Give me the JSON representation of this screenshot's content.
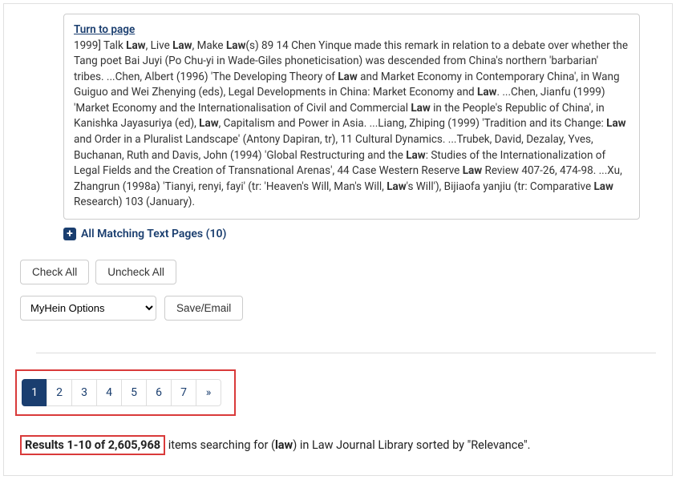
{
  "snippet": {
    "turn_label": "Turn to page",
    "prefix": "1999] Talk ",
    "hl1": "Law",
    "t1": ", Live ",
    "hl2": "Law",
    "t2": ", Make ",
    "hl3": "Law",
    "t3": "(s) 89 14 Chen Yinque made this remark in relation to a debate over whether the Tang poet Bai Juyi (Po Chu-yi in Wade-Giles phoneticisation) was descended from China's northern 'barbarian' tribes. ...Chen, Albert (1996) 'The Developing Theory of ",
    "hl4": "Law",
    "t4": " and Market Economy in Contemporary China', in Wang Guiguo and Wei Zhenying (eds), Legal Developments in China: Market Economy and ",
    "hl5": "Law",
    "t5": ". ...Chen, Jianfu (1999) 'Market Economy and the Internationalisation of Civil and Commercial ",
    "hl6": "Law",
    "t6": " in the People's Republic of China', in Kanishka Jayasuriya (ed), ",
    "hl7": "Law",
    "t7": ", Capitalism and Power in Asia. ...Liang, Zhiping (1999) 'Tradition and its Change: ",
    "hl8": "Law",
    "t8": " and Order in a Pluralist Landscape' (Antony Dapiran, tr), 11 Cultural Dynamics. ...Trubek, David, Dezalay, Yves, Buchanan, Ruth and Davis, John (1994) 'Global Restructuring and the ",
    "hl9": "Law",
    "t9": ": Studies of the Internationalization of Legal Fields and the Creation of Transnational Arenas', 44 Case Western Reserve ",
    "hl10": "Law",
    "t10": " Review 407-26, 474-98. ...Xu, Zhangrun (1998a) 'Tianyi, renyi, fayi' (tr: 'Heaven's Will, Man's Will, ",
    "hl11": "Law",
    "t11": "'s Will'), Bijiaofa yanjiu (tr: Comparative ",
    "hl12": "Law",
    "t12": " Research) 103 (January)."
  },
  "matching": {
    "label": "All Matching Text Pages (10)"
  },
  "buttons": {
    "check_all": "Check All",
    "uncheck_all": "Uncheck All",
    "save_email": "Save/Email"
  },
  "select": {
    "placeholder": "MyHein Options"
  },
  "pagination": {
    "pages": [
      "1",
      "2",
      "3",
      "4",
      "5",
      "6",
      "7"
    ],
    "next_symbol": "»",
    "active": "1"
  },
  "results": {
    "boxed": "Results 1-10 of 2,605,968",
    "tail_pre": " items searching for (",
    "tail_bold": "law",
    "tail_post": ") in Law Journal Library sorted by \"Relevance\"."
  }
}
